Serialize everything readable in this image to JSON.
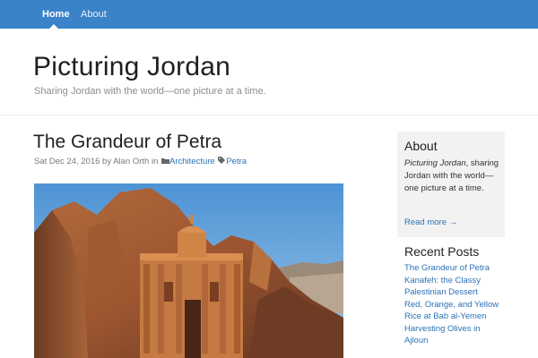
{
  "nav": {
    "items": [
      {
        "label": "Home",
        "active": true
      },
      {
        "label": "About",
        "active": false
      }
    ]
  },
  "site": {
    "title": "Picturing Jordan",
    "tagline": "Sharing Jordan with the world—one picture at a time."
  },
  "post": {
    "title": "The Grandeur of Petra",
    "meta": {
      "date_author": "Sat Dec 24, 2016 by Alan Orth in",
      "folder_icon": "folder-icon",
      "category": "Architecture",
      "tag_icon": "tag-icon",
      "tag": "Petra"
    },
    "image": {
      "description": "photo-petra-monastery"
    }
  },
  "sidebar": {
    "about": {
      "heading": "About",
      "text_em": "Picturing Jordan",
      "text_rest": ", sharing Jordan with the world—one picture at a time.",
      "read_more": "Read more →"
    },
    "recent": {
      "heading": "Recent Posts",
      "items": [
        "The Grandeur of Petra",
        "Kanafeh: the Classy Palestinian Dessert",
        "Red, Orange, and Yellow Rice at Bab al-Yemen",
        "Harvesting Olives in Ajloun"
      ]
    }
  },
  "colors": {
    "nav_bg": "#3a83c8",
    "link": "#2a72b8",
    "sidebar_bg": "#f2f2f2"
  }
}
